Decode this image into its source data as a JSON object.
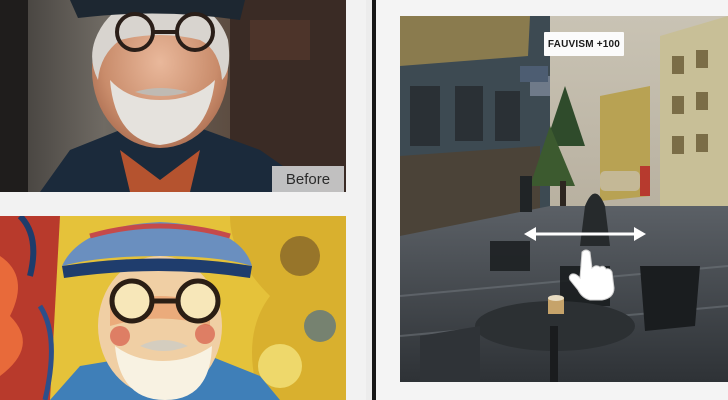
{
  "before_photo": {
    "badge_label": "Before",
    "icon": "portrait-photo-icon"
  },
  "after_photo": {
    "icon": "painted-portrait-icon"
  },
  "filter": {
    "label": "FAUVISM +100"
  },
  "street_photo": {
    "icon": "painted-street-photo-icon"
  },
  "gesture": {
    "icon": "swipe-horizontal-hand-icon"
  }
}
